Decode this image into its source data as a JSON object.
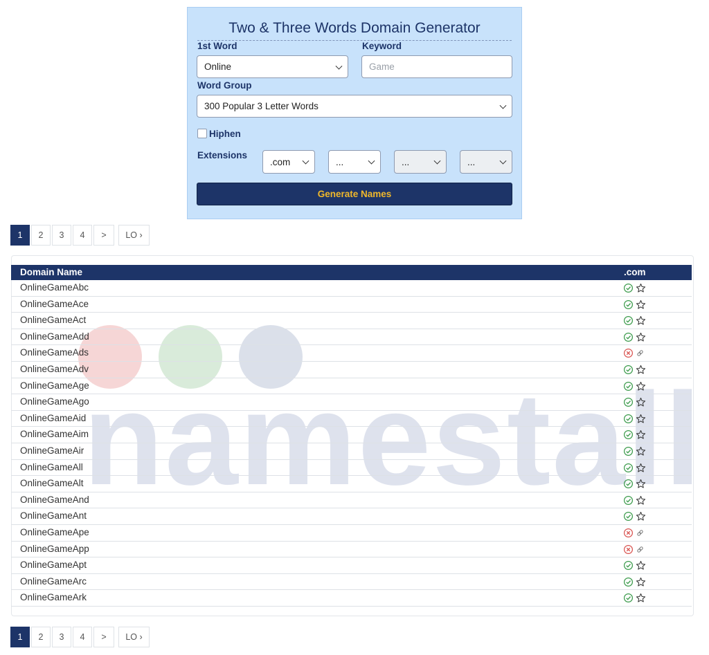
{
  "generator": {
    "title": "Two & Three Words Domain Generator",
    "first_word_label": "1st Word",
    "first_word_value": "Online",
    "keyword_label": "Keyword",
    "keyword_placeholder": "Game",
    "word_group_label": "Word Group",
    "word_group_value": "300 Popular 3 Letter Words",
    "hiphen_label": "Hiphen",
    "hiphen_checked": false,
    "extensions_label": "Extensions",
    "extensions": [
      ".com",
      "...",
      "...",
      "..."
    ],
    "generate_label": "Generate Names"
  },
  "pagination": {
    "pages": [
      "1",
      "2",
      "3",
      "4"
    ],
    "active_page": "1",
    "next_label": ">",
    "last_label": "LO ›"
  },
  "table": {
    "headers": [
      "Domain Name",
      ".com"
    ],
    "rows": [
      {
        "name": "OnlineGameAbc",
        "status": "available"
      },
      {
        "name": "OnlineGameAce",
        "status": "available"
      },
      {
        "name": "OnlineGameAct",
        "status": "available"
      },
      {
        "name": "OnlineGameAdd",
        "status": "available"
      },
      {
        "name": "OnlineGameAds",
        "status": "taken"
      },
      {
        "name": "OnlineGameAdv",
        "status": "available"
      },
      {
        "name": "OnlineGameAge",
        "status": "available"
      },
      {
        "name": "OnlineGameAgo",
        "status": "available"
      },
      {
        "name": "OnlineGameAid",
        "status": "available"
      },
      {
        "name": "OnlineGameAim",
        "status": "available"
      },
      {
        "name": "OnlineGameAir",
        "status": "available"
      },
      {
        "name": "OnlineGameAll",
        "status": "available"
      },
      {
        "name": "OnlineGameAlt",
        "status": "available"
      },
      {
        "name": "OnlineGameAnd",
        "status": "available"
      },
      {
        "name": "OnlineGameAnt",
        "status": "available"
      },
      {
        "name": "OnlineGameApe",
        "status": "taken"
      },
      {
        "name": "OnlineGameApp",
        "status": "taken"
      },
      {
        "name": "OnlineGameApt",
        "status": "available"
      },
      {
        "name": "OnlineGameArc",
        "status": "available"
      },
      {
        "name": "OnlineGameArk",
        "status": "available"
      }
    ]
  },
  "watermark": {
    "text": "namestall",
    "colors": [
      "#f2c4c4",
      "#c9e2cb",
      "#ccd3e1"
    ]
  },
  "colors": {
    "navy": "#1d3468",
    "panel_bg": "#c8e2fb",
    "button_text": "#f0b82b",
    "available": "#3a9a4a",
    "taken": "#d9534f"
  }
}
